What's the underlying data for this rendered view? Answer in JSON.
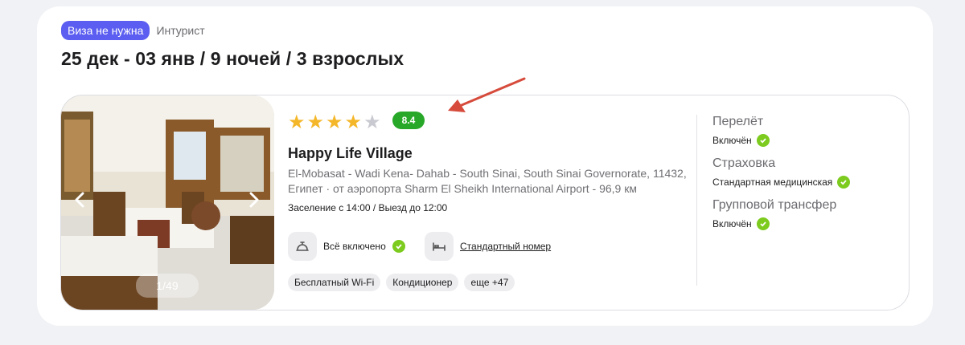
{
  "header": {
    "visa_badge": "Виза не нужна",
    "operator": "Интурист",
    "title": "25 дек - 03 янв / 9 ночей / 3 взрослых"
  },
  "hotel": {
    "stars": 4,
    "stars_max": 5,
    "rating": "8.4",
    "name": "Happy Life Village",
    "address": "El-Mobasat - Wadi Kena- Dahab - South Sinai, South Sinai Governorate, 11432, Египет · от аэропорта Sharm El Sheikh International Airport - 96,9 км",
    "times": "Заселение с 14:00 / Выезд до 12:00",
    "photo_counter": "1/49",
    "meal": "Всё включено",
    "room": "Стандартный номер",
    "chips": [
      "Бесплатный Wi-Fi",
      "Кондиционер",
      "еще +47"
    ]
  },
  "side": {
    "flight_label": "Перелёт",
    "flight_value": "Включён",
    "insurance_label": "Страховка",
    "insurance_value": "Стандартная медицинская",
    "transfer_label": "Групповой трансфер",
    "transfer_value": "Включён"
  },
  "colors": {
    "accent": "#5b5ef0",
    "rating_green": "#28a828",
    "check_green": "#7ccb1e",
    "star": "#f5b72a",
    "star_empty": "#c9c9d1",
    "annotation_arrow": "#d64b3c"
  },
  "icons": {
    "meal": "room-service-bell-icon",
    "room": "bed-icon",
    "check": "check-circle-icon",
    "prev": "chevron-left-icon",
    "next": "chevron-right-icon"
  }
}
